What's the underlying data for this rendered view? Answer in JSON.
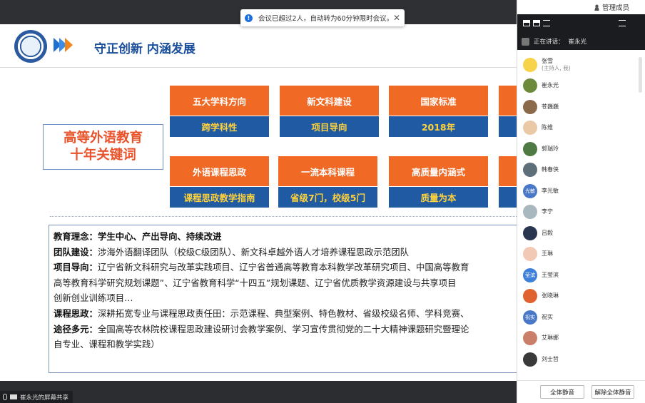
{
  "notification": {
    "text": "会议已超过2人，自动转为60分钟限时会议。",
    "close": "✕"
  },
  "slide": {
    "title": "守正创新 内涵发展",
    "keyword_lines": [
      "高等外语教育",
      "十年关键词"
    ],
    "cards": [
      {
        "top": "五大学科方向",
        "bottom": "跨学科性"
      },
      {
        "top": "新文科建设",
        "bottom": "项目导向"
      },
      {
        "top": "国家标准",
        "bottom": "2018年"
      },
      {
        "top": "",
        "bottom": ""
      },
      {
        "top": "外语课程思政",
        "bottom": "课程思政教学指南"
      },
      {
        "top": "一流本科课程",
        "bottom": "省级7门，校级5门"
      },
      {
        "top": "高质量内涵式",
        "bottom": "质量为本"
      },
      {
        "top": "",
        "bottom": ""
      }
    ],
    "paragraphs": [
      {
        "label": "教育理念：",
        "text": "学生中心、产出导向、持续改进",
        "all_bold": true
      },
      {
        "label": "团队建设：",
        "text": "涉海外语翻译团队（校级C级团队）、新文科卓越外语人才培养课程思政示范团队"
      },
      {
        "label": "项目导向：",
        "text": "辽宁省新文科研究与改革实践项目、辽宁省普通高等教育本科教学改革研究项目、中国高等教育"
      },
      {
        "label": "",
        "text": "高等教育科学研究规划课题”、辽宁省教育科学“十四五”规划课题、辽宁省优质教学资源建设与共享项目"
      },
      {
        "label": "",
        "text": "创新创业训练项目…"
      },
      {
        "label": "课程思政：",
        "text": "深耕拓宽专业与课程思政责任田：示范课程、典型案例、特色教材、省级校级名师、学科竞赛、"
      },
      {
        "label": "途径多元：",
        "text": "全国高等农林院校课程思政建设研讨会教学案例、学习宣传贯彻党的二十大精神课题研究暨理论"
      },
      {
        "label": "",
        "text": "自专业、课程和教学实践）"
      }
    ]
  },
  "share_status": "崔永光的屏幕共享",
  "panel": {
    "manage_members": "管理成员",
    "speaking_label": "正在讲话：",
    "speaking_name": "崔永光",
    "members": [
      {
        "name": "张雪",
        "sub": "(主持人, 我)",
        "avatar": "",
        "color": "#f6d34a"
      },
      {
        "name": "崔永光",
        "sub": "",
        "avatar": "",
        "color": "#6c8a3a"
      },
      {
        "name": "苍巍巍",
        "sub": "",
        "avatar": "",
        "color": "#8a6a4a"
      },
      {
        "name": "陈维",
        "sub": "",
        "avatar": "",
        "color": "#e9c9a6"
      },
      {
        "name": "郭瑞玲",
        "sub": "",
        "avatar": "",
        "color": "#4f7a44"
      },
      {
        "name": "韩春侠",
        "sub": "",
        "avatar": "",
        "color": "#5e6f7a"
      },
      {
        "name": "李光敏",
        "sub": "",
        "avatar": "光敏",
        "color": "#4a78c8"
      },
      {
        "name": "李宁",
        "sub": "",
        "avatar": "",
        "color": "#a9b7bf"
      },
      {
        "name": "吕毅",
        "sub": "",
        "avatar": "",
        "color": "#2a3550"
      },
      {
        "name": "王琳",
        "sub": "",
        "avatar": "",
        "color": "#f2c9b4"
      },
      {
        "name": "王莹滨",
        "sub": "",
        "avatar": "莹滨",
        "color": "#3d7fd9"
      },
      {
        "name": "张晓琳",
        "sub": "",
        "avatar": "",
        "color": "#e0622f"
      },
      {
        "name": "祝实",
        "sub": "",
        "avatar": "祝实",
        "color": "#4a78c8"
      },
      {
        "name": "艾琳娜",
        "sub": "",
        "avatar": "",
        "color": "#c97f6a"
      },
      {
        "name": "刘士哲",
        "sub": "",
        "avatar": "",
        "color": "#3a3a3a"
      }
    ],
    "mute_all": "全体静音",
    "unmute_all": "解除全体静音"
  }
}
